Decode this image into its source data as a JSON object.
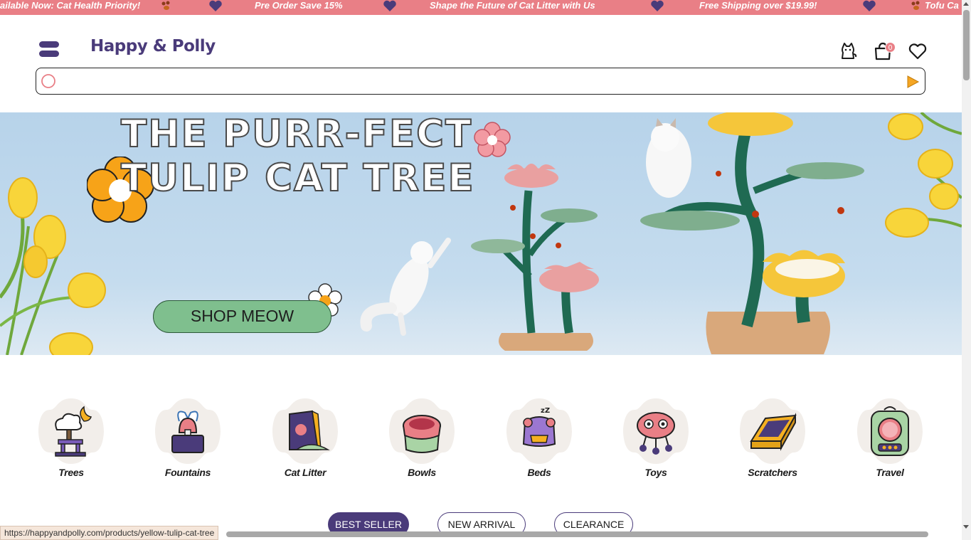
{
  "announcement": {
    "items": [
      "ailable Now: Cat Health Priority!",
      "Pre Order Save 15%",
      "Shape the Future of Cat Litter with Us",
      "Free Shipping over $19.99!",
      "Tofu Ca"
    ]
  },
  "header": {
    "logo": "Happy & Polly",
    "cart_count": "0"
  },
  "search": {
    "placeholder": ""
  },
  "hero": {
    "title_line1": "THE PURR-FECT",
    "title_line2": "TULIP CAT TREE",
    "cta": "SHOP MEOW"
  },
  "categories": [
    {
      "label": "Trees",
      "icon": "cat-tree-icon"
    },
    {
      "label": "Fountains",
      "icon": "fountain-icon"
    },
    {
      "label": "Cat Litter",
      "icon": "litter-bag-icon"
    },
    {
      "label": "Bowls",
      "icon": "bowl-icon"
    },
    {
      "label": "Beds",
      "icon": "bed-icon"
    },
    {
      "label": "Toys",
      "icon": "toy-icon"
    },
    {
      "label": "Scratchers",
      "icon": "scratcher-icon"
    },
    {
      "label": "Travel",
      "icon": "travel-backpack-icon"
    }
  ],
  "tabs": [
    {
      "label": "BEST SELLER",
      "active": true
    },
    {
      "label": "NEW ARRIVAL",
      "active": false
    },
    {
      "label": "CLEARANCE",
      "active": false
    }
  ],
  "status_bar": {
    "url": "https://happyandpolly.com/products/yellow-tulip-cat-tree"
  },
  "colors": {
    "announcement_bg": "#e97f86",
    "brand_purple": "#4a3b7a",
    "cta_green": "#7fbf8e",
    "hero_sky": "#b7d3ea"
  }
}
